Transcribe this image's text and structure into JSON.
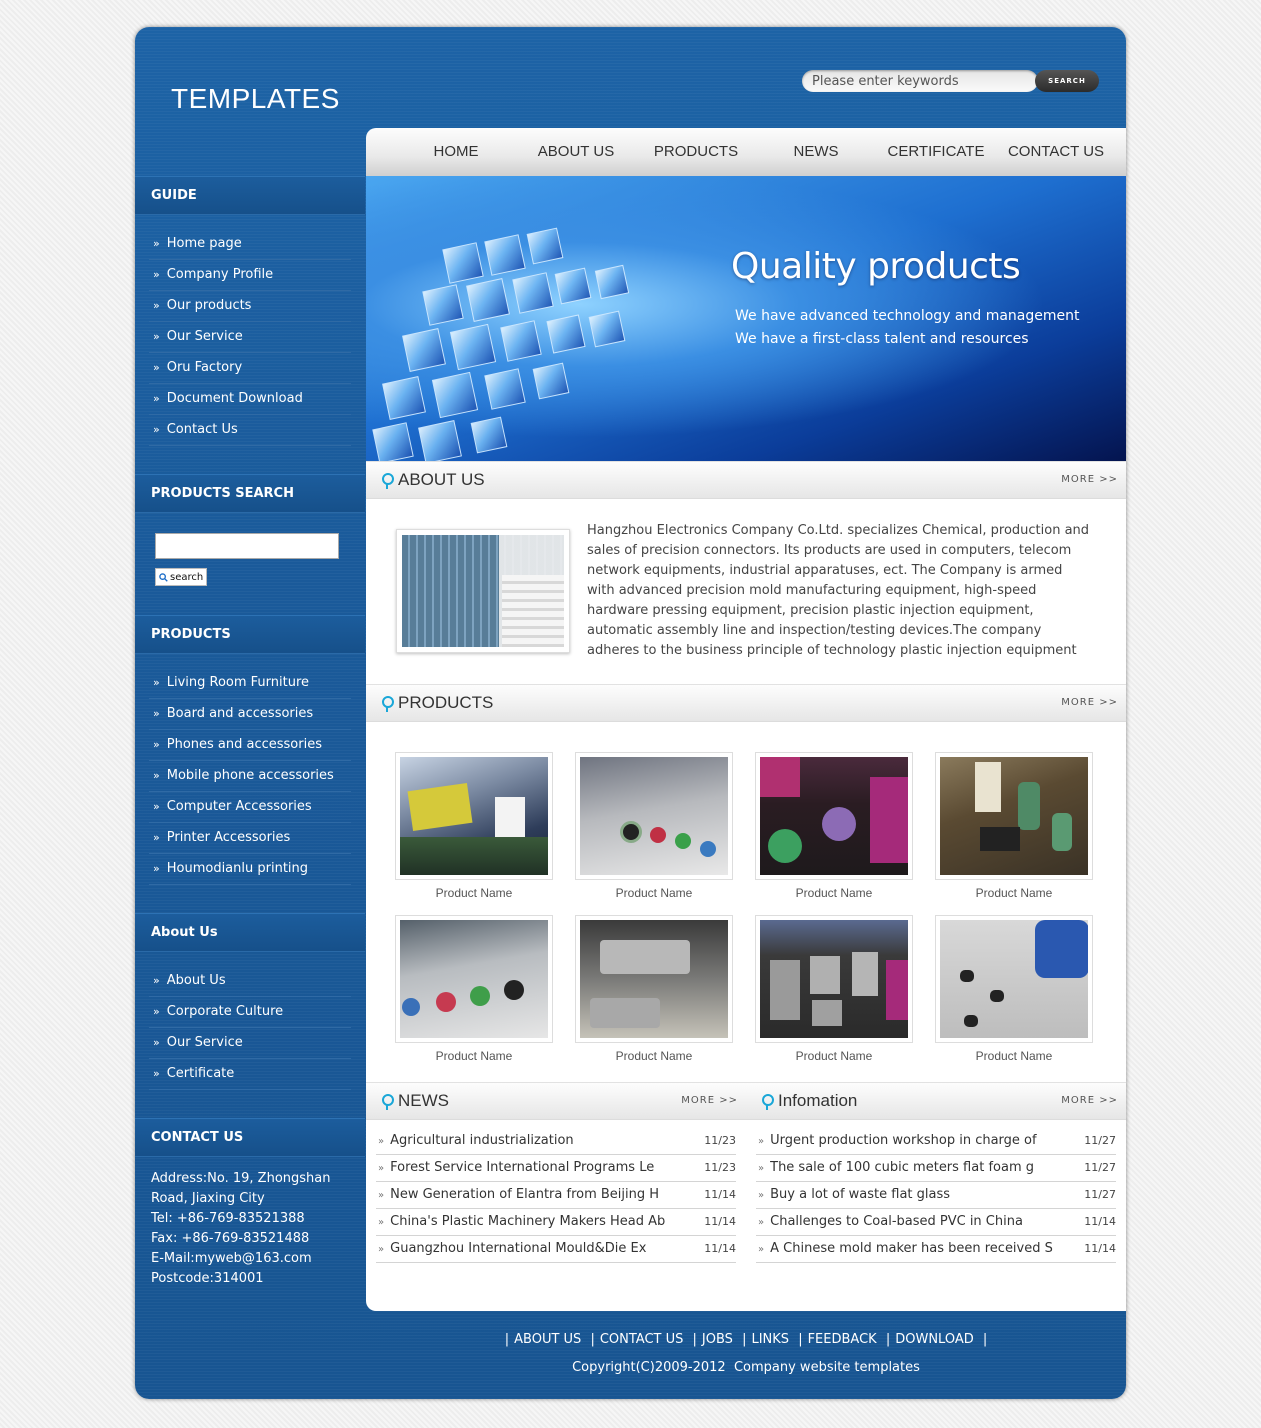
{
  "header": {
    "logo": "TEMPLATES",
    "search": {
      "placeholder": "Please enter keywords",
      "button": "Search"
    }
  },
  "nav": [
    "HOME",
    "ABOUT US",
    "PRODUCTS",
    "NEWS",
    "CERTIFICATE",
    "CONTACT US"
  ],
  "sidebar": {
    "guide": {
      "title": "GUIDE",
      "items": [
        "Home page",
        "Company Profile",
        "Our products",
        "Our Service",
        "Oru Factory",
        "Document Download",
        "Contact Us"
      ]
    },
    "products_search": {
      "title": "PRODUCTS SEARCH",
      "value": "",
      "button": "search"
    },
    "products": {
      "title": "PRODUCTS",
      "items": [
        "Living Room Furniture",
        "Board and accessories",
        "Phones and accessories",
        "Mobile phone accessories",
        "Computer Accessories",
        "Printer Accessories",
        "Houmodianlu printing"
      ]
    },
    "about": {
      "title": "About Us",
      "items": [
        "About Us",
        "Corporate Culture",
        "Our Service",
        "Certificate"
      ]
    },
    "contact": {
      "title": "CONTACT US",
      "lines": [
        "Address:No. 19, Zhongshan",
        "Road, Jiaxing City",
        "Tel: +86-769-83521388",
        "Fax: +86-769-83521488",
        "E-Mail:myweb@163.com",
        "Postcode:314001"
      ]
    }
  },
  "banner": {
    "title": "Quality products",
    "line1": "We have advanced technology and management",
    "line2": "We have a first-class talent and resources"
  },
  "about": {
    "title": "ABOUT US",
    "more": "MORE >>",
    "text": "Hangzhou Electronics Company Co.Ltd. specializes Chemical, production and sales of precision connectors. Its products are used in computers, telecom network equipments, industrial apparatuses, ect. The Company is armed with advanced precision mold manufacturing equipment, high-speed hardware pressing equipment, precision plastic injection equipment, automatic assembly line and inspection/testing devices.The company adheres to the business principle of technology plastic injection equipment"
  },
  "products": {
    "title": "PRODUCTS",
    "more": "MORE >>",
    "items": [
      "Product Name",
      "Product Name",
      "Product Name",
      "Product Name",
      "Product Name",
      "Product Name",
      "Product Name",
      "Product Name"
    ]
  },
  "news": {
    "title": "NEWS",
    "more": "MORE >>",
    "items": [
      {
        "text": "Agricultural industrialization",
        "date": "11/23"
      },
      {
        "text": "Forest Service International Programs Le",
        "date": "11/23"
      },
      {
        "text": "New Generation of Elantra from Beijing H",
        "date": "11/14"
      },
      {
        "text": "China's Plastic Machinery Makers Head Ab",
        "date": "11/14"
      },
      {
        "text": "Guangzhou International Mould&Die Ex",
        "date": "11/14"
      }
    ]
  },
  "info": {
    "title": "Infomation",
    "more": "MORE >>",
    "items": [
      {
        "text": "Urgent production workshop in charge of",
        "date": "11/27"
      },
      {
        "text": "The sale of 100 cubic meters flat foam g",
        "date": "11/27"
      },
      {
        "text": "Buy a lot of waste flat glass",
        "date": "11/27"
      },
      {
        "text": "Challenges to Coal-based PVC in China",
        "date": "11/14"
      },
      {
        "text": "A Chinese mold maker has been received S",
        "date": "11/14"
      }
    ]
  },
  "footer": {
    "links": [
      "ABOUT US",
      "CONTACT US",
      "JOBS",
      "LINKS",
      "FEEDBACK",
      "DOWNLOAD"
    ],
    "copyright": "Copyright(C)2009-2012  Company website templates"
  }
}
